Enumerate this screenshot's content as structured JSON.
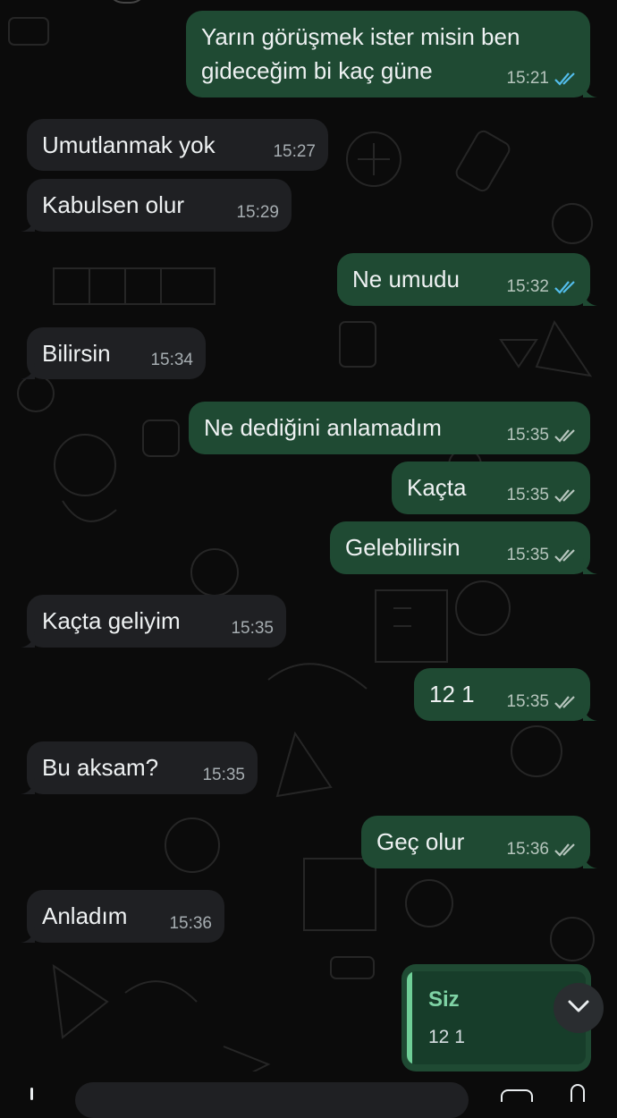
{
  "messages": [
    {
      "dir": "out",
      "text": "Yarın görüşmek ister misin ben gideceğim bi kaç güne",
      "time": "15:21",
      "ticks": "read"
    },
    {
      "dir": "in",
      "text": "Umutlanmak yok",
      "time": "15:27"
    },
    {
      "dir": "in",
      "text": "Kabulsen olur",
      "time": "15:29"
    },
    {
      "dir": "out",
      "text": "Ne umudu",
      "time": "15:32",
      "ticks": "read"
    },
    {
      "dir": "in",
      "text": "Bilirsin",
      "time": "15:34"
    },
    {
      "dir": "out",
      "text": "Ne dediğini anlamadım",
      "time": "15:35",
      "ticks": "delivered"
    },
    {
      "dir": "out",
      "text": "Kaçta",
      "time": "15:35",
      "ticks": "delivered"
    },
    {
      "dir": "out",
      "text": "Gelebilirsin",
      "time": "15:35",
      "ticks": "delivered"
    },
    {
      "dir": "in",
      "text": "Kaçta geliyim",
      "time": "15:35"
    },
    {
      "dir": "out",
      "text": "12 1",
      "time": "15:35",
      "ticks": "delivered"
    },
    {
      "dir": "in",
      "text": "Bu aksam?",
      "time": "15:35"
    },
    {
      "dir": "out",
      "text": "Geç olur",
      "time": "15:36",
      "ticks": "delivered"
    },
    {
      "dir": "in",
      "text": "Anladım",
      "time": "15:36"
    }
  ],
  "reply_preview": {
    "author": "Siz",
    "quoted_text": "12 1"
  },
  "icons": {
    "scroll_down": "chevron-down-icon",
    "read": "double-check-blue-icon",
    "delivered": "double-check-gray-icon"
  },
  "colors": {
    "incoming_bubble": "#1f2023",
    "outgoing_bubble": "#1f4a33",
    "read_ticks": "#53bdeb",
    "reply_accent": "#6fcf97"
  }
}
